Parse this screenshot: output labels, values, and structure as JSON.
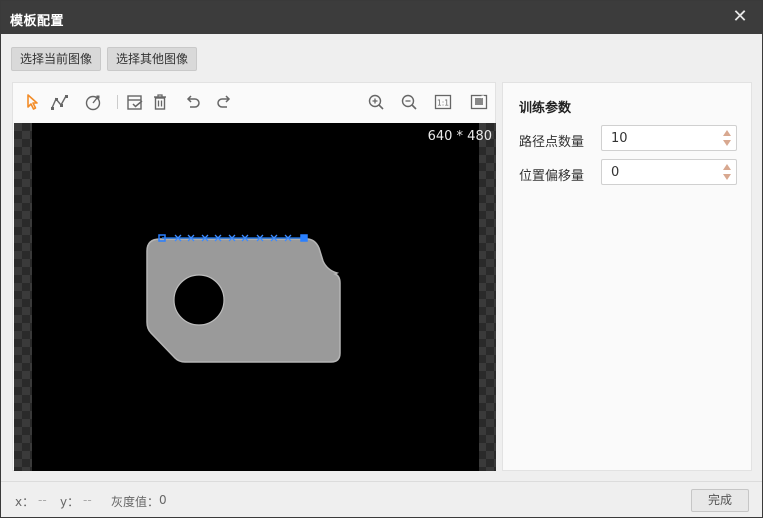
{
  "window": {
    "title": "模板配置"
  },
  "top_buttons": {
    "select_current": "选择当前图像",
    "select_other": "选择其他图像"
  },
  "toolbar": {
    "tools": [
      "select-icon",
      "polyline-icon",
      "circle-path-icon",
      "edit-path-icon",
      "delete-icon",
      "undo-icon",
      "redo-icon",
      "zoom-in-icon",
      "zoom-out-icon",
      "actual-size-icon",
      "fit-window-icon"
    ],
    "actual_size_label": "1:1",
    "accent_color": "#f28c28"
  },
  "canvas": {
    "image_size": "640 * 480"
  },
  "params": {
    "title": "训练参数",
    "path_points_label": "路径点数量",
    "path_points_value": "10",
    "offset_label": "位置偏移量",
    "offset_value": "0"
  },
  "status": {
    "x_label": "x：",
    "x_value": "--",
    "y_label": "y：",
    "y_value": "--",
    "gray_label": "灰度值：",
    "gray_value": "0"
  },
  "footer": {
    "done_label": "完成"
  }
}
